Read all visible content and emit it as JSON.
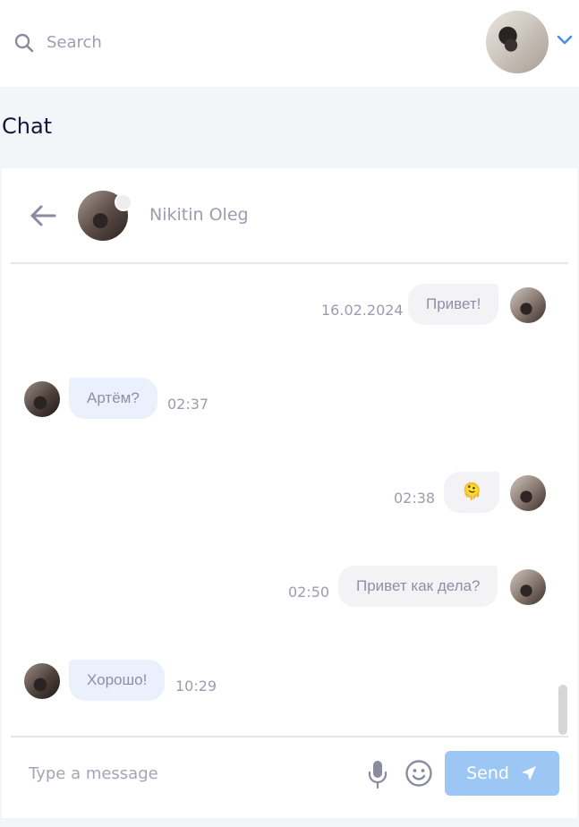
{
  "header": {
    "search_placeholder": "Search",
    "search_value": ""
  },
  "page": {
    "title": "Chat"
  },
  "chat": {
    "contact_name": "Nikitin Oleg",
    "messages": [
      {
        "direction": "out",
        "text": "Привет!",
        "time": "16.02.2024"
      },
      {
        "direction": "in",
        "text": "Артём?",
        "time": "02:37"
      },
      {
        "direction": "out",
        "text": "🫠",
        "time": "02:38"
      },
      {
        "direction": "out",
        "text": "Привет как дела?",
        "time": "02:50"
      },
      {
        "direction": "in",
        "text": "Хорошо!",
        "time": "10:29"
      }
    ]
  },
  "composer": {
    "placeholder": "Type a message",
    "value": "",
    "send_label": "Send"
  },
  "colors": {
    "accent": "#9cc6f4",
    "incoming_bubble": "#eaf1fd",
    "outgoing_bubble": "#f3f3f6",
    "title": "#16163a"
  },
  "icons": {
    "search": "search-icon",
    "profile_menu": "chevron-down-icon",
    "back": "arrow-left-icon",
    "mic": "microphone-icon",
    "emoji": "smiley-icon",
    "send": "paper-plane-icon"
  }
}
